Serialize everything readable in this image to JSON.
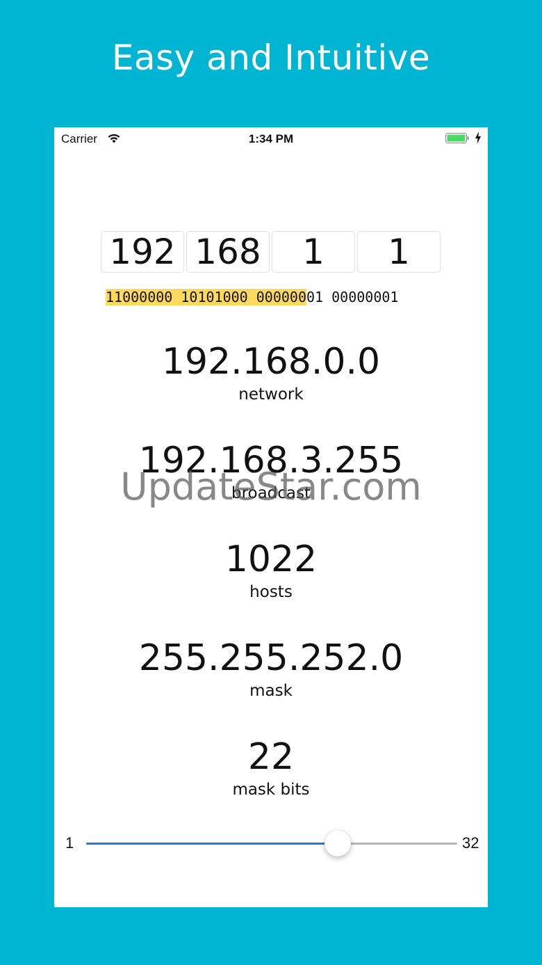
{
  "headline": "Easy and Intuitive",
  "status_bar": {
    "carrier": "Carrier",
    "time": "1:34 PM",
    "icons": [
      "wifi-icon",
      "battery-icon",
      "charging-bolt-icon"
    ]
  },
  "ip_octets": [
    "192",
    "168",
    "1",
    "1"
  ],
  "binary": {
    "highlighted": "11000000 10101000 000000",
    "rest": "01 00000001"
  },
  "network": {
    "value": "192.168.0.0",
    "label": "network"
  },
  "broadcast": {
    "value": "192.168.3.255",
    "label": "broadcast"
  },
  "hosts": {
    "value": "1022",
    "label": "hosts"
  },
  "mask": {
    "value": "255.255.252.0",
    "label": "mask"
  },
  "mask_bits": {
    "value": "22",
    "label": "mask bits"
  },
  "slider": {
    "min": "1",
    "max": "32",
    "value": 22,
    "min_value": 1,
    "max_value": 32
  },
  "watermark": "UpdateStar.com",
  "colors": {
    "background": "#00b5d1",
    "highlight": "#ffd95e",
    "slider_fill": "#1a7fd6",
    "battery": "#4cd964"
  }
}
